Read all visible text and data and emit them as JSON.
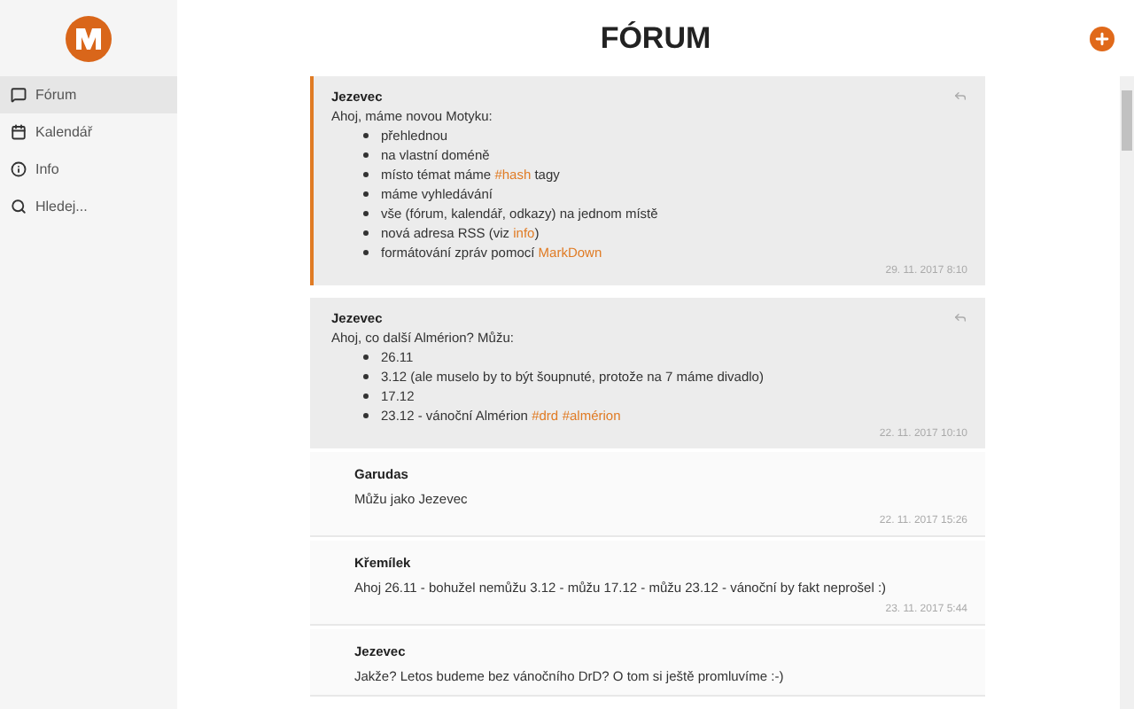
{
  "sidebar": {
    "items": [
      {
        "label": "Fórum",
        "selected": true
      },
      {
        "label": "Kalendář",
        "selected": false
      },
      {
        "label": "Info",
        "selected": false
      },
      {
        "label": "Hledej...",
        "selected": false
      }
    ]
  },
  "header": {
    "title": "FÓRUM"
  },
  "posts": [
    {
      "kind": "post",
      "highlighted": true,
      "author": "Jezevec",
      "intro": [
        {
          "kind": "text",
          "text": "Ahoj, máme novou Motyku:"
        }
      ],
      "list": [
        [
          {
            "kind": "text",
            "text": "přehlednou"
          }
        ],
        [
          {
            "kind": "text",
            "text": "na vlastní doméně"
          }
        ],
        [
          {
            "kind": "text",
            "text": "místo témat máme "
          },
          {
            "kind": "link",
            "text": "#hash"
          },
          {
            "kind": "text",
            "text": " tagy"
          }
        ],
        [
          {
            "kind": "text",
            "text": "máme vyhledávání"
          }
        ],
        [
          {
            "kind": "text",
            "text": "vše (fórum, kalendář, odkazy) na jednom místě"
          }
        ],
        [
          {
            "kind": "text",
            "text": "nová adresa RSS (viz "
          },
          {
            "kind": "link",
            "text": "info"
          },
          {
            "kind": "text",
            "text": ")"
          }
        ],
        [
          {
            "kind": "text",
            "text": "formátování zpráv pomocí "
          },
          {
            "kind": "link",
            "text": "MarkDown"
          }
        ]
      ],
      "time": "29. 11. 2017 8:10"
    },
    {
      "kind": "post",
      "highlighted": false,
      "author": "Jezevec",
      "intro": [
        {
          "kind": "text",
          "text": "Ahoj, co další Almérion? Můžu:"
        }
      ],
      "list": [
        [
          {
            "kind": "text",
            "text": "26.11"
          }
        ],
        [
          {
            "kind": "text",
            "text": "3.12 (ale muselo by to být šoupnuté, protože na 7 máme divadlo)"
          }
        ],
        [
          {
            "kind": "text",
            "text": "17.12"
          }
        ],
        [
          {
            "kind": "text",
            "text": "23.12 - vánoční Almérion "
          },
          {
            "kind": "link",
            "text": "#drd"
          },
          {
            "kind": "link",
            "text": "#almérion"
          }
        ]
      ],
      "time": "22. 11. 2017 10:10"
    },
    {
      "kind": "reply",
      "author": "Garudas",
      "intro": [
        {
          "kind": "text",
          "text": "Můžu jako Jezevec"
        }
      ],
      "time": "22. 11. 2017 15:26"
    },
    {
      "kind": "reply",
      "author": "Křemílek",
      "intro": [
        {
          "kind": "text",
          "text": "Ahoj 26.11 - bohužel nemůžu 3.12 - můžu 17.12 - můžu 23.12 - vánoční by fakt neprošel :)"
        }
      ],
      "time": "23. 11. 2017 5:44"
    },
    {
      "kind": "reply",
      "author": "Jezevec",
      "intro": [
        {
          "kind": "text",
          "text": "Jakže? Letos budeme bez vánočního DrD? O tom si ještě promluvíme :-)"
        }
      ]
    }
  ]
}
